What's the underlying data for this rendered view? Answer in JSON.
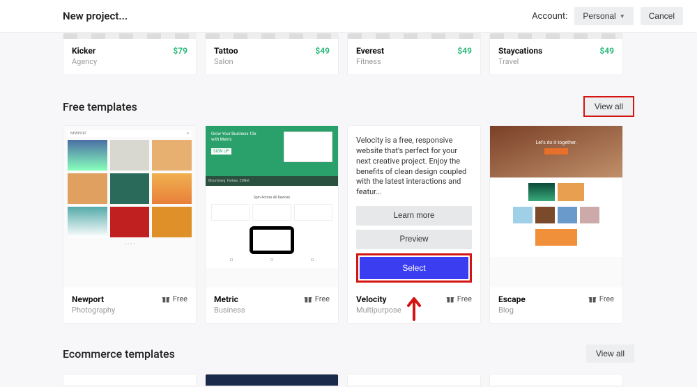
{
  "header": {
    "title": "New project...",
    "account_label": "Account:",
    "personal_label": "Personal",
    "cancel_label": "Cancel"
  },
  "top_templates": [
    {
      "name": "Kicker",
      "category": "Agency",
      "price": "$79"
    },
    {
      "name": "Tattoo",
      "category": "Salon",
      "price": "$49"
    },
    {
      "name": "Everest",
      "category": "Fitness",
      "price": "$49"
    },
    {
      "name": "Staycations",
      "category": "Travel",
      "price": "$49"
    }
  ],
  "free_section": {
    "title": "Free templates",
    "view_all": "View all",
    "free_label": "Free",
    "items": [
      {
        "name": "Newport",
        "category": "Photography"
      },
      {
        "name": "Metric",
        "category": "Business"
      },
      {
        "name": "Velocity",
        "category": "Multipurpose"
      },
      {
        "name": "Escape",
        "category": "Blog"
      }
    ],
    "velocity": {
      "description": "Velocity is a free, responsive website that's perfect for your next creative project. Enjoy the benefits of clean design coupled with the latest interactions and featur...",
      "learn_more": "Learn more",
      "preview": "Preview",
      "select": "Select"
    }
  },
  "ecommerce_section": {
    "title": "Ecommerce templates",
    "view_all": "View all"
  },
  "escape_hero_text": "Let's do it together."
}
